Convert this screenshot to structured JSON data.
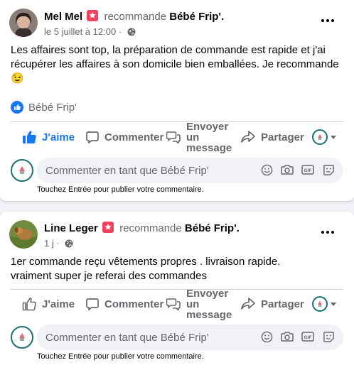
{
  "posts": [
    {
      "author": "Mel Mel",
      "verb": "recommande",
      "page": "Bébé Frip'.",
      "date": "le 5 juillet à 12:00",
      "sep": "·",
      "text_lines": [
        "Les affaires sont top, la préparation de commande est rapide et j'ai",
        "récupérer les affaires à son domicile bien emballées. Je recommande"
      ],
      "emoji": "😉",
      "reaction_by": "Bébé Frip'",
      "like_label": "J'aime",
      "liked": true
    },
    {
      "author": "Line Leger",
      "verb": "recommande",
      "page": "Bébé Frip'.",
      "date": "1 j",
      "sep": "·",
      "text_lines": [
        "1er commande reçu vêtements propres . livraison rapide.",
        "vraiment super je referai des commandes"
      ],
      "like_label": "J'aime",
      "liked": false
    }
  ],
  "actions": {
    "comment": "Commenter",
    "message_lines": [
      "Envoyer",
      "un",
      "message"
    ],
    "share": "Partager"
  },
  "composer": {
    "placeholder": "Commenter en tant que Bébé Frip'",
    "hint": "Touchez Entrée pour publier votre commentaire."
  },
  "colors": {
    "accent": "#1877f2",
    "muted": "#65676b",
    "badge": "#f3425f",
    "page_ring": "#1d6f74"
  },
  "icons": [
    "smile-icon",
    "camera-icon",
    "gif-icon",
    "sticker-icon",
    "globe-icon",
    "more-dots-icon"
  ]
}
